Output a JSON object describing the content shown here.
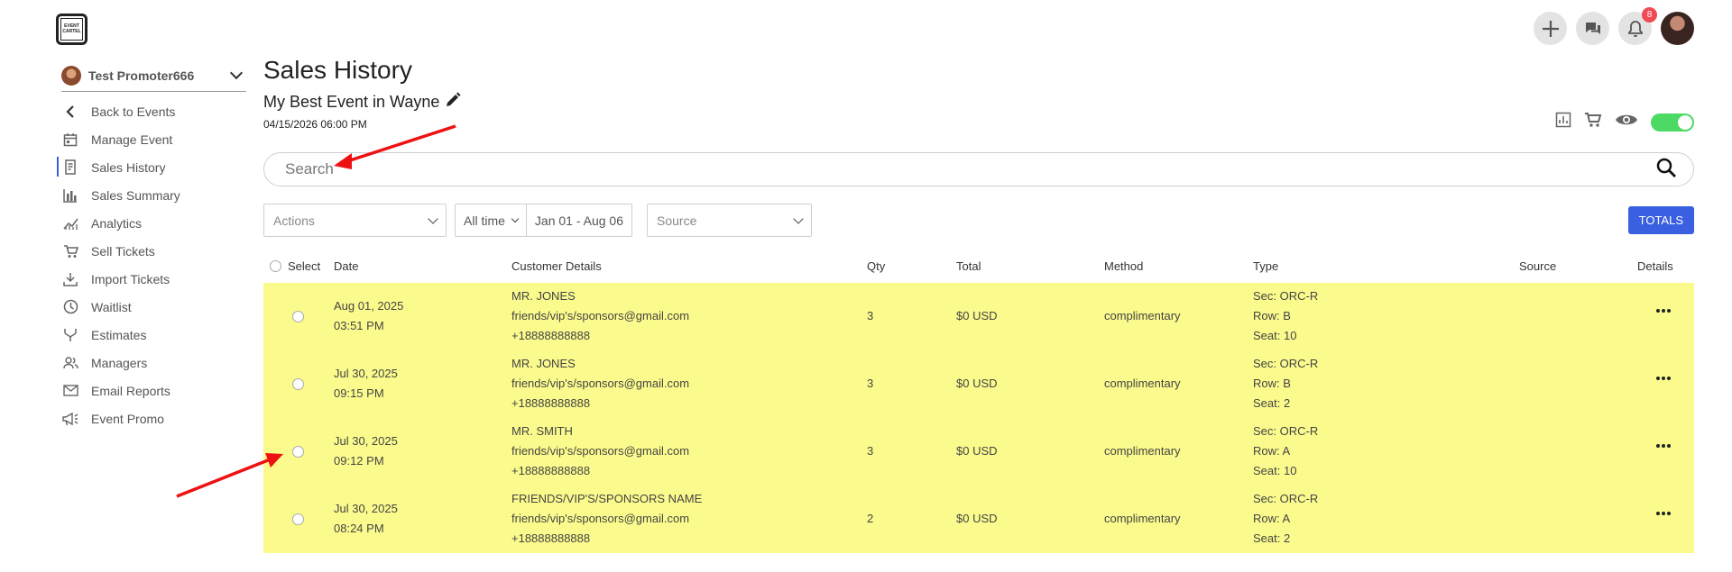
{
  "logo": {
    "text_line1": "EVENT",
    "text_line2": "CARTEL"
  },
  "topbar": {
    "notification_count": "8"
  },
  "sidebar": {
    "org_name": "Test Promoter666",
    "items": [
      {
        "label": "Back to Events",
        "icon": "chevron-left-icon"
      },
      {
        "label": "Manage Event",
        "icon": "calendar-icon"
      },
      {
        "label": "Sales History",
        "icon": "receipt-icon",
        "active": true
      },
      {
        "label": "Sales Summary",
        "icon": "bar-chart-icon"
      },
      {
        "label": "Analytics",
        "icon": "analytics-icon"
      },
      {
        "label": "Sell Tickets",
        "icon": "cart-icon"
      },
      {
        "label": "Import Tickets",
        "icon": "download-icon"
      },
      {
        "label": "Waitlist",
        "icon": "clock-icon"
      },
      {
        "label": "Estimates",
        "icon": "merge-icon"
      },
      {
        "label": "Managers",
        "icon": "people-icon"
      },
      {
        "label": "Email Reports",
        "icon": "mail-icon"
      },
      {
        "label": "Event Promo",
        "icon": "megaphone-icon"
      }
    ]
  },
  "main": {
    "title": "Sales History",
    "event_name": "My Best Event in Wayne",
    "event_date": "04/15/2026 06:00 PM",
    "search_placeholder": "Search",
    "filters": {
      "actions_placeholder": "Actions",
      "time_range": "All time",
      "date_range": "Jan 01 - Aug 06",
      "source_placeholder": "Source",
      "totals_label": "TOTALS"
    },
    "table": {
      "headers": {
        "select": "Select",
        "date": "Date",
        "customer": "Customer Details",
        "qty": "Qty",
        "total": "Total",
        "method": "Method",
        "type": "Type",
        "source": "Source",
        "details": "Details"
      },
      "rows": [
        {
          "date": "Aug 01, 2025",
          "time": "03:51 PM",
          "name": "MR. JONES",
          "email": "friends/vip's/sponsors@gmail.com",
          "phone": "+18888888888",
          "qty": "3",
          "total": "$0 USD",
          "method": "complimentary",
          "sec": "Sec: ORC-R",
          "row": "Row: B",
          "seat": "Seat: 10",
          "source": ""
        },
        {
          "date": "Jul 30, 2025",
          "time": "09:15 PM",
          "name": "MR. JONES",
          "email": "friends/vip's/sponsors@gmail.com",
          "phone": "+18888888888",
          "qty": "3",
          "total": "$0 USD",
          "method": "complimentary",
          "sec": "Sec: ORC-R",
          "row": "Row: B",
          "seat": "Seat: 2",
          "source": ""
        },
        {
          "date": "Jul 30, 2025",
          "time": "09:12 PM",
          "name": "MR. SMITH",
          "email": "friends/vip's/sponsors@gmail.com",
          "phone": "+18888888888",
          "qty": "3",
          "total": "$0 USD",
          "method": "complimentary",
          "sec": "Sec: ORC-R",
          "row": "Row: A",
          "seat": "Seat: 10",
          "source": ""
        },
        {
          "date": "Jul 30, 2025",
          "time": "08:24 PM",
          "name": "FRIENDS/VIP'S/SPONSORS NAME",
          "email": "friends/vip's/sponsors@gmail.com",
          "phone": "+18888888888",
          "qty": "2",
          "total": "$0 USD",
          "method": "complimentary",
          "sec": "Sec: ORC-R",
          "row": "Row: A",
          "seat": "Seat: 2",
          "source": ""
        }
      ]
    }
  },
  "colors": {
    "accent": "#3a5fe0",
    "row_highlight": "#fbfb8d",
    "toggle_on": "#4cd964",
    "annotation": "#ee1111",
    "badge": "#f04b55"
  }
}
